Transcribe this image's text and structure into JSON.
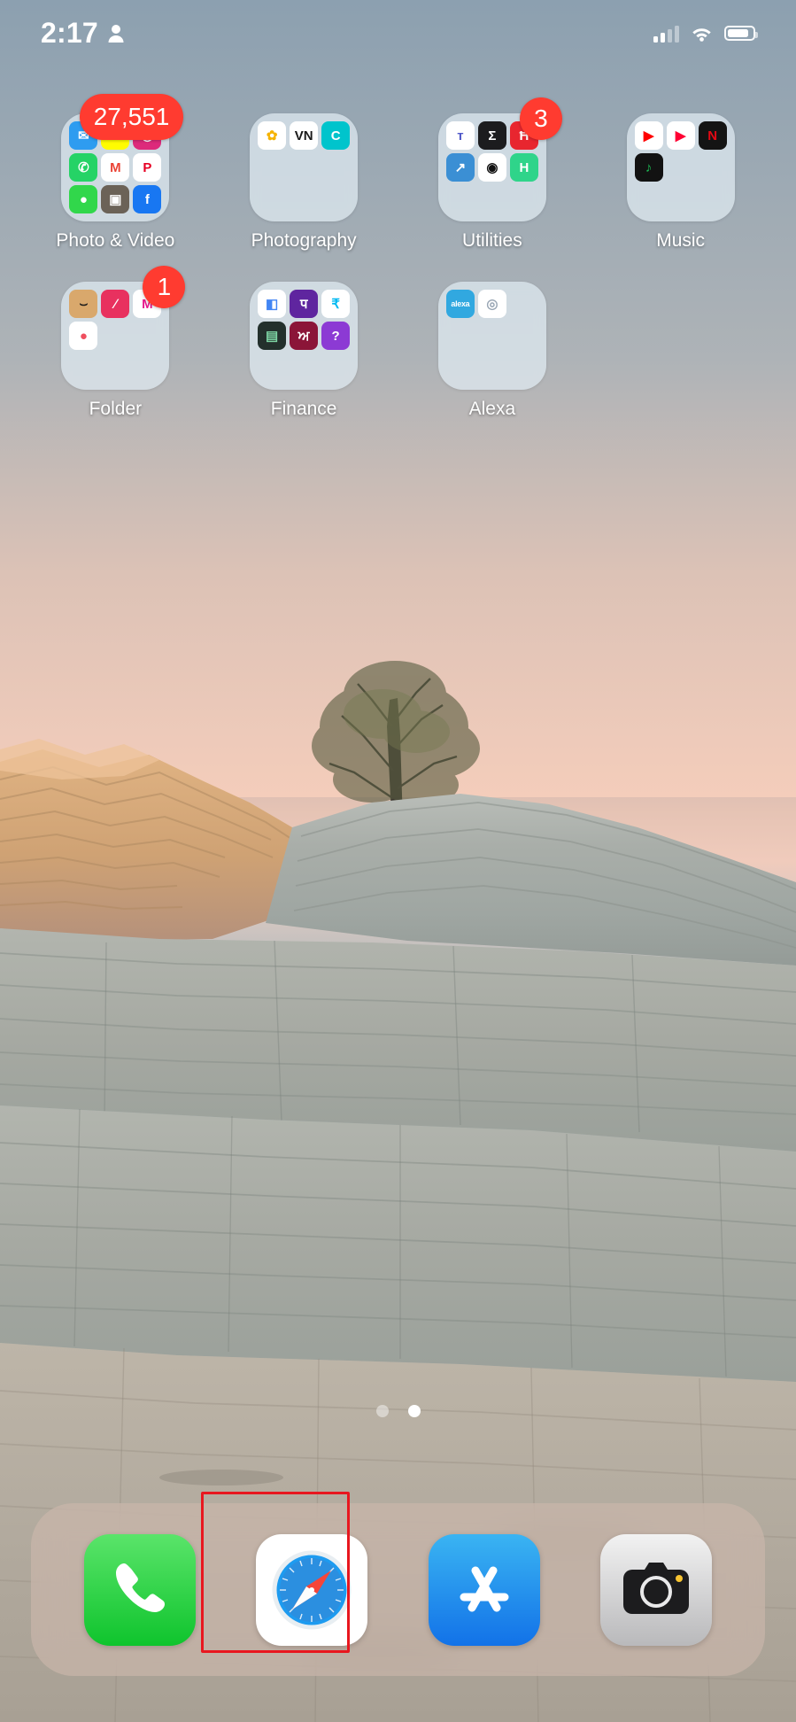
{
  "device": "iphone-home-screen",
  "status_bar": {
    "time": "2:17",
    "person_icon": "person-icon",
    "cellular_icon": "signal-bars-icon",
    "wifi_icon": "wifi-icon",
    "battery_icon": "battery-icon",
    "battery_level_pct": 86
  },
  "home": {
    "page_dots": {
      "count": 2,
      "active_index": 1
    },
    "folders": [
      {
        "label": "Photo & Video",
        "badge": "27,551",
        "badge_shape": "wide",
        "apps": [
          {
            "name": "Mail",
            "glyph": "✉",
            "bg": "#2e9cf0",
            "fg": "#ffffff"
          },
          {
            "name": "Snapchat",
            "glyph": "◔",
            "bg": "#fffc00",
            "fg": "#ffffff"
          },
          {
            "name": "Instagram",
            "glyph": "◎",
            "bg": "#dd2a7b",
            "fg": "#ffffff"
          },
          {
            "name": "WhatsApp",
            "glyph": "✆",
            "bg": "#25d366",
            "fg": "#ffffff"
          },
          {
            "name": "Gmail",
            "glyph": "M",
            "bg": "#ffffff",
            "fg": "#ea4335"
          },
          {
            "name": "Pinterest",
            "glyph": "P",
            "bg": "#ffffff",
            "fg": "#e60023"
          },
          {
            "name": "Messages",
            "glyph": "●",
            "bg": "#31d74b",
            "fg": "#ffffff"
          },
          {
            "name": "Photo App",
            "glyph": "▣",
            "bg": "#6b6257",
            "fg": "#ffffff"
          },
          {
            "name": "Facebook",
            "glyph": "f",
            "bg": "#1877f2",
            "fg": "#ffffff"
          }
        ]
      },
      {
        "label": "Photography",
        "badge": null,
        "badge_shape": null,
        "apps": [
          {
            "name": "Photos",
            "glyph": "✿",
            "bg": "#ffffff",
            "fg": "#f5b301"
          },
          {
            "name": "VN",
            "glyph": "VN",
            "bg": "#ffffff",
            "fg": "#1a1a1a"
          },
          {
            "name": "Canva",
            "glyph": "C",
            "bg": "#00c4cc",
            "fg": "#ffffff"
          }
        ]
      },
      {
        "label": "Utilities",
        "badge": "3",
        "badge_shape": "round",
        "apps": [
          {
            "name": "Microsoft Teams",
            "glyph": "ᴛ",
            "bg": "#ffffff",
            "fg": "#5059c9"
          },
          {
            "name": "Math Solver",
            "glyph": "Σ",
            "bg": "#1c1c1e",
            "fg": "#ffffff"
          },
          {
            "name": "Hero App",
            "glyph": "Ħ",
            "bg": "#e8262f",
            "fg": "#ffffff"
          },
          {
            "name": "Stocks Chart",
            "glyph": "↗",
            "bg": "#3b8fd4",
            "fg": "#ffffff"
          },
          {
            "name": "Record Player",
            "glyph": "◉",
            "bg": "#ffffff",
            "fg": "#111111"
          },
          {
            "name": "Health H",
            "glyph": "H",
            "bg": "#2fd48a",
            "fg": "#ffffff"
          }
        ]
      },
      {
        "label": "Music",
        "badge": null,
        "badge_shape": null,
        "apps": [
          {
            "name": "YouTube",
            "glyph": "▶",
            "bg": "#ffffff",
            "fg": "#ff0000"
          },
          {
            "name": "YouTube Music",
            "glyph": "▶",
            "bg": "#ffffff",
            "fg": "#ff0033"
          },
          {
            "name": "Netflix",
            "glyph": "N",
            "bg": "#141414",
            "fg": "#e50914"
          },
          {
            "name": "Spotify",
            "glyph": "♪",
            "bg": "#121212",
            "fg": "#1db954"
          }
        ]
      },
      {
        "label": "Folder",
        "badge": "1",
        "badge_shape": "round",
        "apps": [
          {
            "name": "Amazon",
            "glyph": "⌣",
            "bg": "#d9a86c",
            "fg": "#1a1a1a"
          },
          {
            "name": "Nykaa",
            "glyph": "∕",
            "bg": "#e8315f",
            "fg": "#ffffff"
          },
          {
            "name": "Myntra",
            "glyph": "M",
            "bg": "#ffffff",
            "fg": "#e6198c"
          },
          {
            "name": "Zomato",
            "glyph": "●",
            "bg": "#ffffff",
            "fg": "#ef4f5f"
          }
        ]
      },
      {
        "label": "Finance",
        "badge": null,
        "badge_shape": null,
        "apps": [
          {
            "name": "Google Pay",
            "glyph": "◧",
            "bg": "#ffffff",
            "fg": "#4285f4"
          },
          {
            "name": "PhonePe",
            "glyph": "प",
            "bg": "#5f259f",
            "fg": "#ffffff"
          },
          {
            "name": "Paytm",
            "glyph": "₹",
            "bg": "#ffffff",
            "fg": "#00b9f1"
          },
          {
            "name": "Ledger",
            "glyph": "▤",
            "bg": "#23302c",
            "fg": "#7ed6a5"
          },
          {
            "name": "Angel One",
            "glyph": "ਅ",
            "bg": "#8b1538",
            "fg": "#ffffff"
          },
          {
            "name": "Groww",
            "glyph": "?",
            "bg": "#8c3ad4",
            "fg": "#ffffff"
          }
        ]
      },
      {
        "label": "Alexa",
        "badge": null,
        "badge_shape": null,
        "apps": [
          {
            "name": "Amazon Alexa",
            "glyph": "alexa",
            "bg": "#31a8e0",
            "fg": "#ffffff"
          },
          {
            "name": "Echo Device",
            "glyph": "◎",
            "bg": "#ffffff",
            "fg": "#9aa7b5"
          }
        ]
      }
    ]
  },
  "dock": {
    "apps": [
      {
        "name": "Phone",
        "icon": "phone-icon",
        "highlighted": false
      },
      {
        "name": "Safari",
        "icon": "compass-icon",
        "highlighted": false
      },
      {
        "name": "App Store",
        "icon": "app-store-icon",
        "highlighted": true
      },
      {
        "name": "Camera",
        "icon": "camera-icon",
        "highlighted": false
      }
    ]
  },
  "annotation": {
    "highlight_color": "#e8171f",
    "highlight_target": "App Store"
  }
}
